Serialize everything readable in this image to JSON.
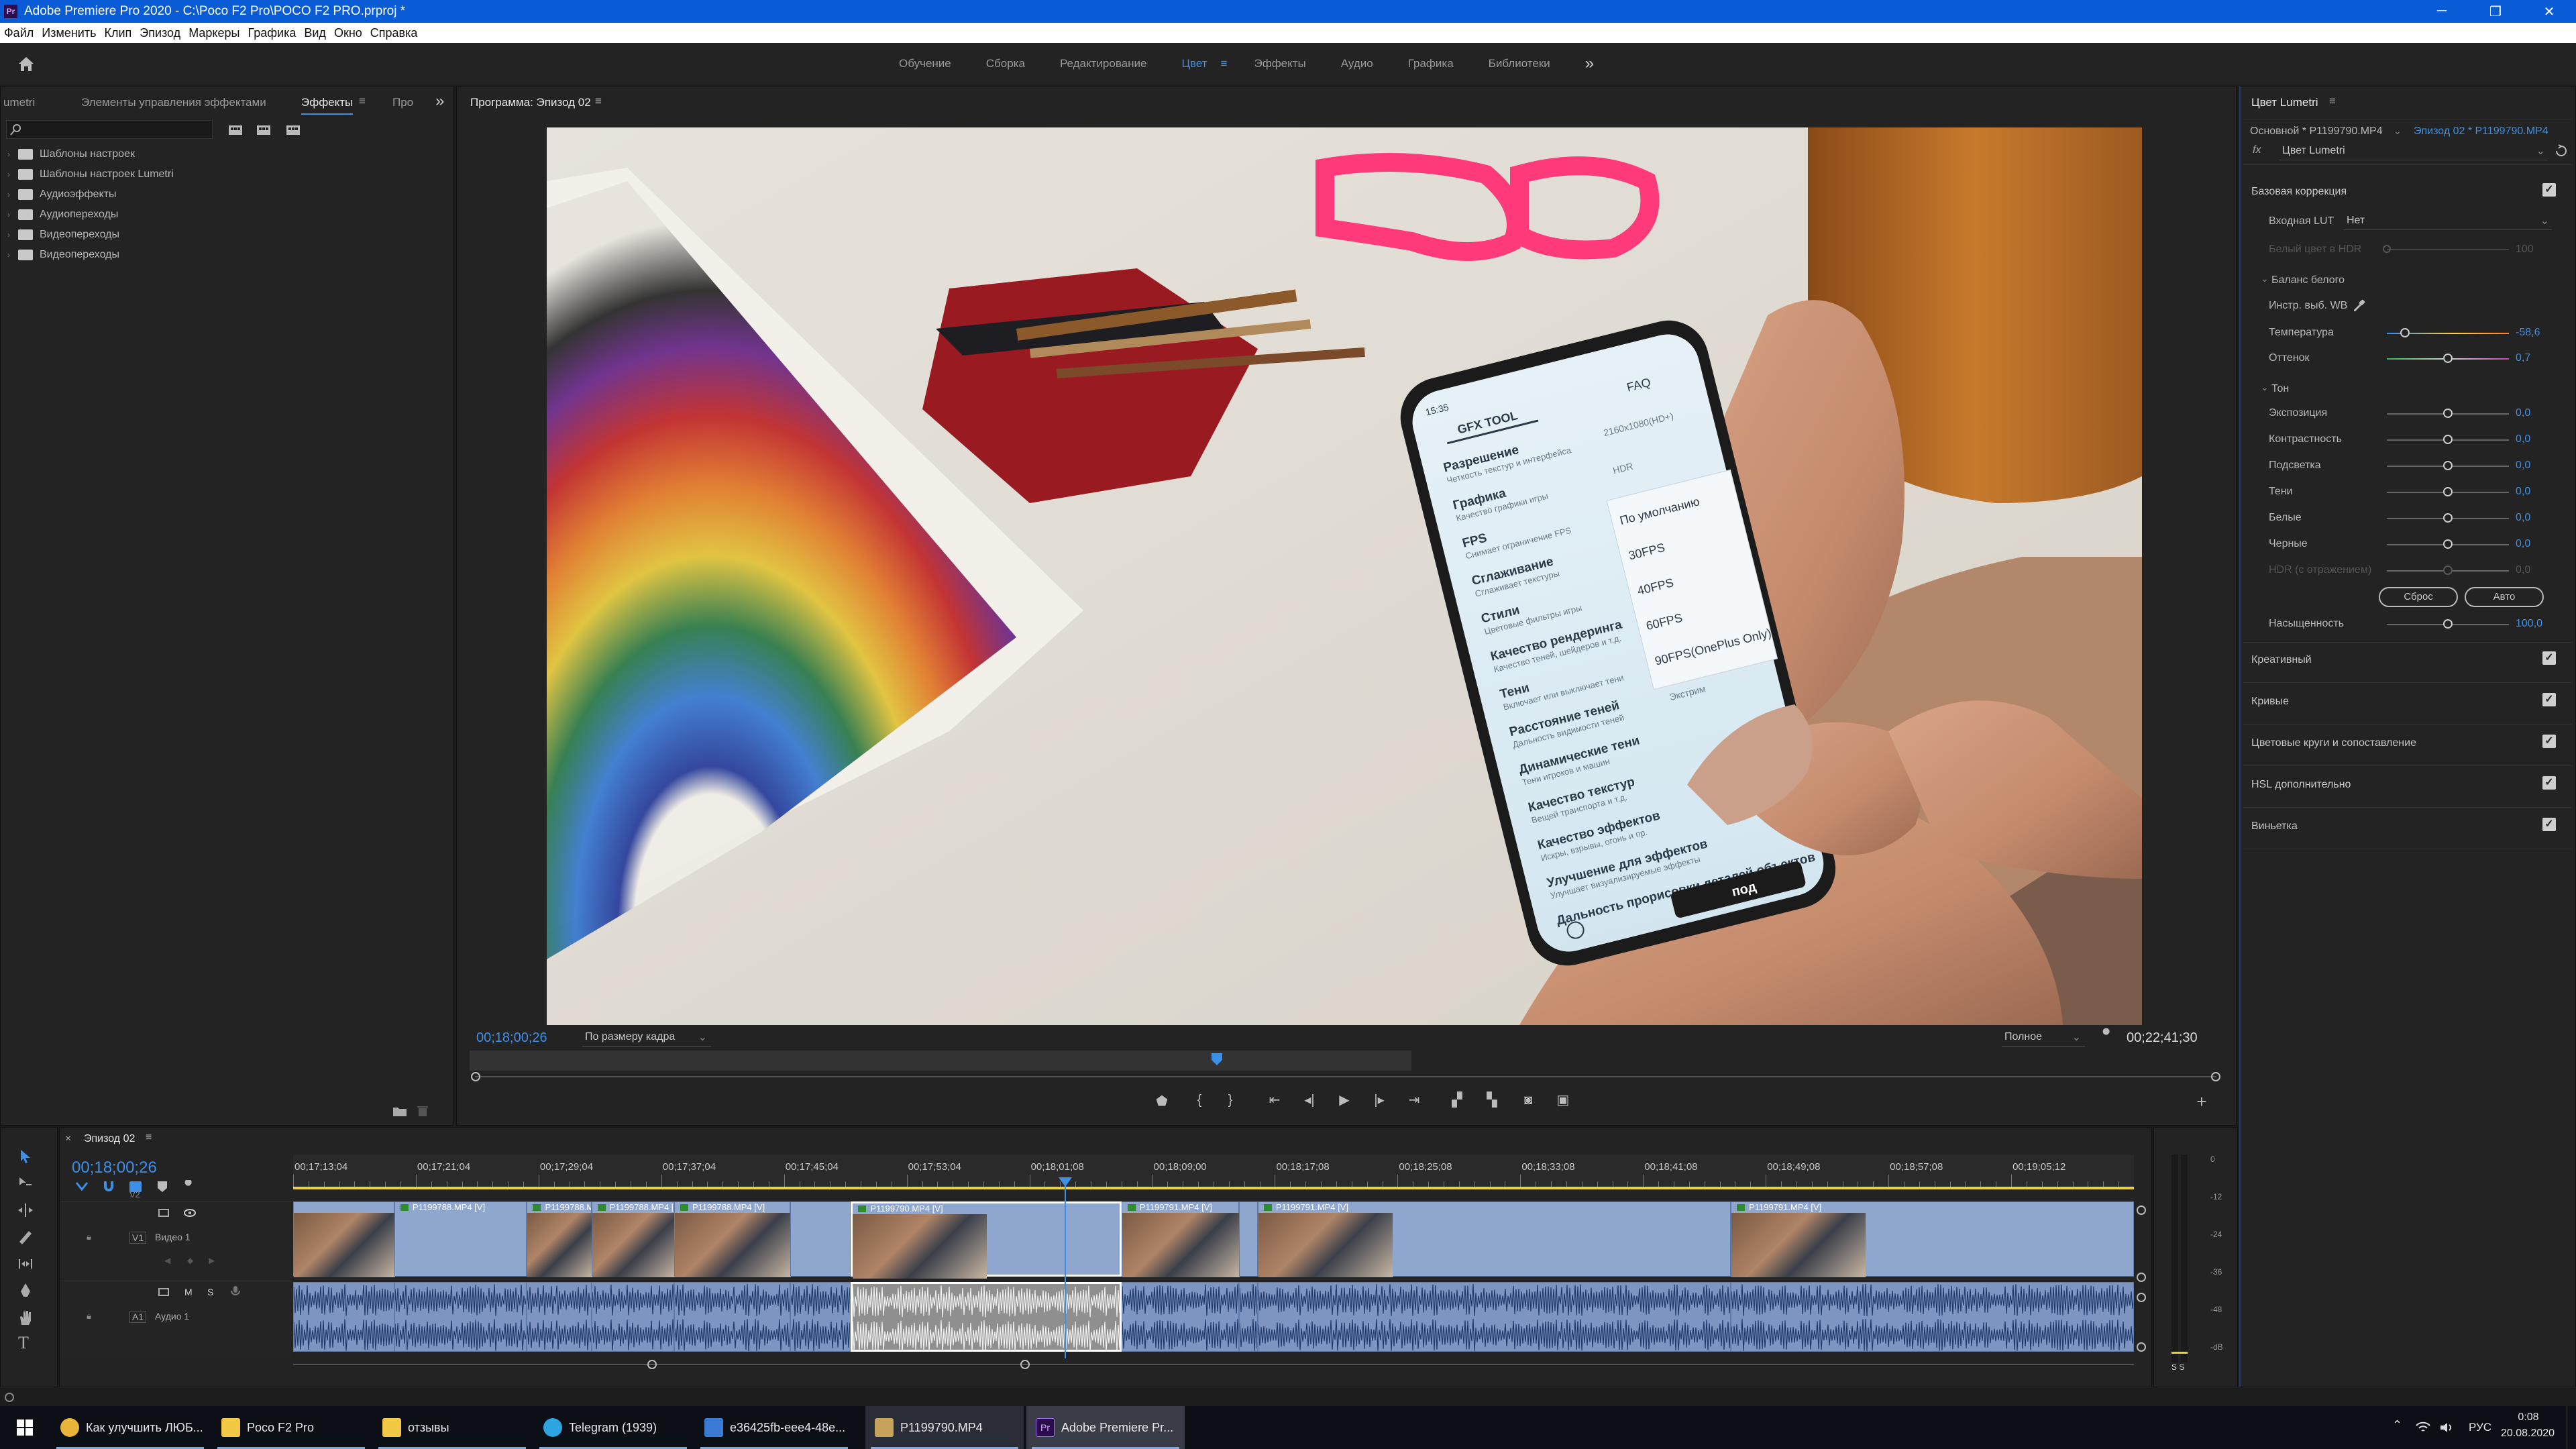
{
  "window": {
    "title": "Adobe Premiere Pro 2020 - C:\\Poco F2 Pro\\POCO F2 PRO.prproj *",
    "minimize": "─",
    "maximize": "❐",
    "close": "✕"
  },
  "menu": [
    "Файл",
    "Изменить",
    "Клип",
    "Эпизод",
    "Маркеры",
    "Графика",
    "Вид",
    "Окно",
    "Справка"
  ],
  "workspaces": {
    "items": [
      "Обучение",
      "Сборка",
      "Редактирование"
    ],
    "active": "Цвет",
    "active_menu": "≡",
    "rest": [
      "Эффекты",
      "Аудио",
      "Графика",
      "Библиотеки"
    ],
    "more": "»"
  },
  "left_panel": {
    "tabs": [
      "umetri",
      "Элементы управления эффектами",
      "Эффекты",
      "Про"
    ],
    "active_tab": "Эффекты",
    "menu_glyph": "≡",
    "more": "»",
    "tree": [
      "Шаблоны настроек",
      "Шаблоны настроек Lumetri",
      "Аудиоэффекты",
      "Аудиопереходы",
      "Видеопереходы",
      "Видеопереходы"
    ]
  },
  "program_monitor": {
    "title": "Программа: Эпизод 02",
    "menu_glyph": "≡",
    "timecode_left": "00;18;00;26",
    "fit": "По размеру кадра",
    "quality": "Полное",
    "timecode_right": "00;22;41;30",
    "phone": {
      "status": "15:35",
      "tab_active": "GFX TOOL",
      "tab_other": "FAQ",
      "settings": [
        {
          "t": "Разрешение",
          "s": "Четкость текстур и интерфейса",
          "v": "2160x1080(HD+)"
        },
        {
          "t": "Графика",
          "s": "Качество графики игры",
          "v": "HDR"
        },
        {
          "t": "FPS",
          "s": "Снимает ограничение FPS",
          "v": ""
        },
        {
          "t": "Сглаживание",
          "s": "Сглаживает текстуры",
          "v": ""
        },
        {
          "t": "Стили",
          "s": "Цветовые фильтры игры",
          "v": ""
        },
        {
          "t": "Качество рендеринга",
          "s": "Качество теней, шейдеров и т.д.",
          "v": ""
        },
        {
          "t": "Тени",
          "s": "Включает или выключает тени",
          "v": ""
        },
        {
          "t": "Расстояние теней",
          "s": "Дальность видимости теней",
          "v": "Экстрим"
        },
        {
          "t": "Динамические тени",
          "s": "Тени игроков и машин",
          "v": ""
        },
        {
          "t": "Качество текстур",
          "s": "Вещей транспорта и т.д.",
          "v": ""
        },
        {
          "t": "Качество эффектов",
          "s": "Искры, взрывы, огонь и пр.",
          "v": ""
        },
        {
          "t": "Улучшение для эффектов",
          "s": "Улучшает визуализируемые эффекты",
          "v": ""
        },
        {
          "t": "Дальность прорисовки деталей объектов",
          "s": "",
          "v": ""
        }
      ],
      "dropdown": [
        "По умолчанию",
        "30FPS",
        "40FPS",
        "60FPS",
        "90FPS(OnePlus Only)"
      ],
      "bottom_btn": "под"
    }
  },
  "lumetri": {
    "title": "Цвет Lumetri",
    "menu_glyph": "≡",
    "source": "Основной * P1199790.MP4",
    "sequence": "Эпизод 02 * P1199790.MP4",
    "fx_label": "fx",
    "effect": "Цвет Lumetri",
    "basic": "Базовая коррекция",
    "input_lut_label": "Входная LUT",
    "input_lut_value": "Нет",
    "hdr_white_label": "Белый цвет в HDR",
    "hdr_white_value": "100",
    "wb_section": "Баланс белого",
    "wb_picker": "Инстр. выб. WB",
    "temperature": {
      "label": "Температура",
      "value": "-58,6",
      "pos": 0.15
    },
    "tint": {
      "label": "Оттенок",
      "value": "0,7",
      "pos": 0.5
    },
    "tone_section": "Тон",
    "tone": [
      {
        "label": "Экспозиция",
        "value": "0,0",
        "pos": 0.5,
        "dim": false
      },
      {
        "label": "Контрастность",
        "value": "0,0",
        "pos": 0.5,
        "dim": false
      },
      {
        "label": "Подсветка",
        "value": "0,0",
        "pos": 0.5,
        "dim": false
      },
      {
        "label": "Тени",
        "value": "0,0",
        "pos": 0.5,
        "dim": false
      },
      {
        "label": "Белые",
        "value": "0,0",
        "pos": 0.5,
        "dim": false
      },
      {
        "label": "Черные",
        "value": "0,0",
        "pos": 0.5,
        "dim": false
      },
      {
        "label": "HDR (с отражением)",
        "value": "0,0",
        "pos": 0.5,
        "dim": true
      }
    ],
    "reset_btn": "Сброс",
    "auto_btn": "Авто",
    "saturation": {
      "label": "Насыщенность",
      "value": "100,0",
      "pos": 0.5
    },
    "sections": [
      "Креативный",
      "Кривые",
      "Цветовые круги и сопоставление",
      "HSL дополнительно",
      "Виньетка"
    ]
  },
  "timeline": {
    "title": "Эпизод 02",
    "menu_glyph": "≡",
    "timecode": "00;18;00;26",
    "ruler": [
      "00;17;13;04",
      "00;17;21;04",
      "00;17;29;04",
      "00;17;37;04",
      "00;17;45;04",
      "00;17;53;04",
      "00;18;01;08",
      "00;18;09;00",
      "00;18;17;08",
      "00;18;25;08",
      "00;18;33;08",
      "00;18;41;08",
      "00;18;49;08",
      "00;18;57;08",
      "00;19;05;12"
    ],
    "v2": "V2",
    "v1": "V1",
    "v1_name": "Видео 1",
    "a1": "A1",
    "a1_name": "Аудио 1",
    "clips": [
      {
        "name": "",
        "x": 0.0,
        "w": 0.055,
        "thumb": true
      },
      {
        "name": "P1199788.MP4 [V]",
        "x": 0.055,
        "w": 0.072,
        "thumb": false
      },
      {
        "name": "P1199788.MP4 [V]",
        "x": 0.127,
        "w": 0.035,
        "thumb": true
      },
      {
        "name": "P1199788.MP4 [V]",
        "x": 0.162,
        "w": 0.045,
        "thumb": true
      },
      {
        "name": "P1199788.MP4 [V]",
        "x": 0.207,
        "w": 0.063,
        "thumb": true
      },
      {
        "name": "",
        "x": 0.27,
        "w": 0.033,
        "thumb": false
      },
      {
        "name": "P1199790.MP4 [V]",
        "x": 0.303,
        "w": 0.147,
        "thumb": true
      },
      {
        "name": "P1199791.MP4 [V]",
        "x": 0.45,
        "w": 0.064,
        "thumb": true
      },
      {
        "name": "",
        "x": 0.514,
        "w": 0.01,
        "thumb": false
      },
      {
        "name": "P1199791.MP4 [V]",
        "x": 0.524,
        "w": 0.257,
        "thumb": true
      },
      {
        "name": "P1199791.MP4 [V]",
        "x": 0.781,
        "w": 0.219,
        "thumb": true
      }
    ],
    "meter": [
      "0",
      "-12",
      "-24",
      "-36",
      "-48",
      "-dB"
    ],
    "meter_solo": "S S"
  },
  "taskbar": {
    "items": [
      {
        "label": "Как улучшить ЛЮБ...",
        "color": "#e8b43a"
      },
      {
        "label": "Poco F2 Pro",
        "color": "#f2c744"
      },
      {
        "label": "отзывы",
        "color": "#f2c744"
      },
      {
        "label": "Telegram (1939)",
        "color": "#2ca5e0"
      },
      {
        "label": "e36425fb-eee4-48e...",
        "color": "#3a7bd5"
      },
      {
        "label": "P1199790.MP4",
        "color": "#c7a25a"
      },
      {
        "label": "Adobe Premiere Pr...",
        "color": "#2a0d4d"
      }
    ],
    "lang": "РУС",
    "time": "0:08",
    "date": "20.08.2020"
  }
}
